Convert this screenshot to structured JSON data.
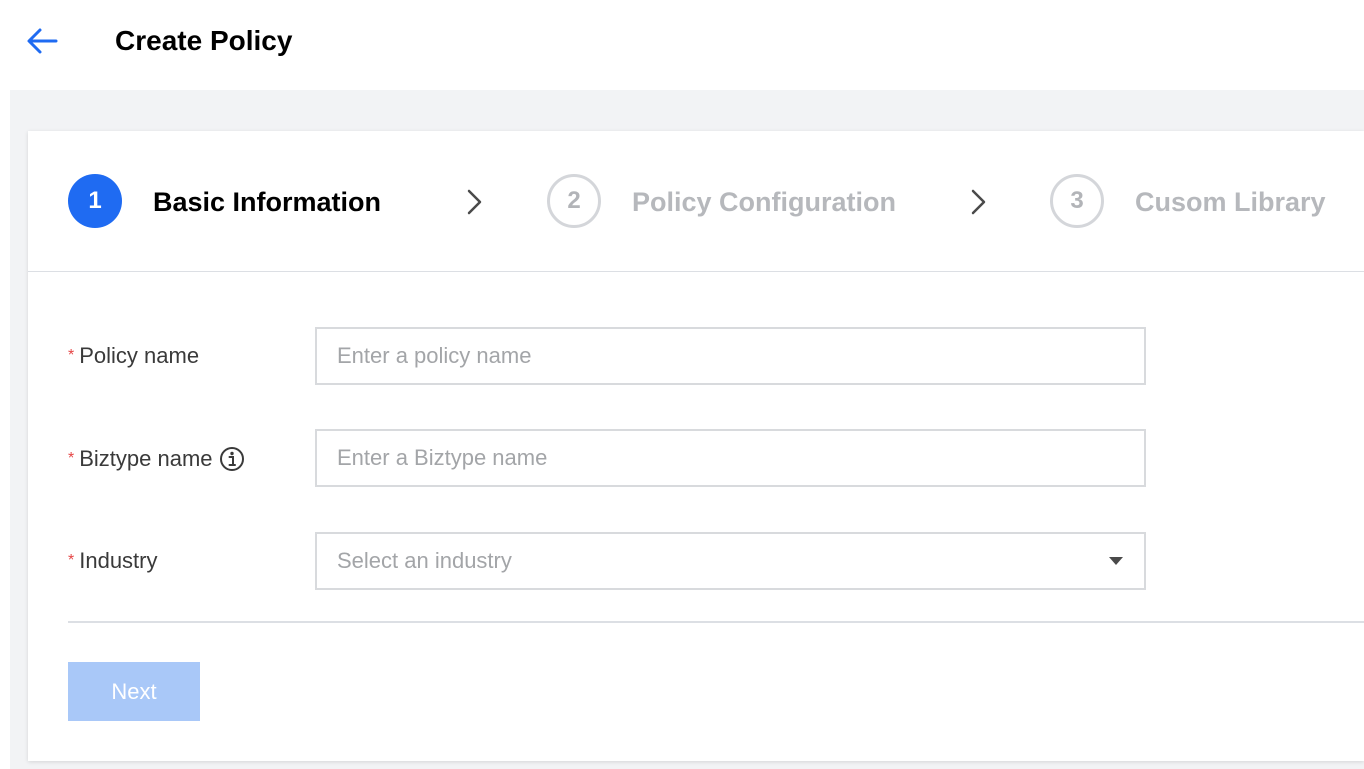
{
  "header": {
    "title": "Create Policy",
    "back_icon": "arrow-left-icon"
  },
  "colors": {
    "accent": "#1f6bf2",
    "required": "#e54545",
    "disabled_button": "#a9c8f8"
  },
  "steps": [
    {
      "number": "1",
      "label": "Basic Information",
      "state": "active"
    },
    {
      "number": "2",
      "label": "Policy Configuration",
      "state": "inactive"
    },
    {
      "number": "3",
      "label": "Cusom Library",
      "state": "inactive"
    }
  ],
  "form": {
    "required_mark": "*",
    "policy_name": {
      "label": "Policy name",
      "value": "",
      "placeholder": "Enter a policy name"
    },
    "biztype_name": {
      "label": "Biztype name",
      "value": "",
      "placeholder": "Enter a Biztype name",
      "info_icon": "info-circle-icon"
    },
    "industry": {
      "label": "Industry",
      "placeholder": "Select an industry",
      "selected": ""
    }
  },
  "actions": {
    "next_label": "Next"
  }
}
